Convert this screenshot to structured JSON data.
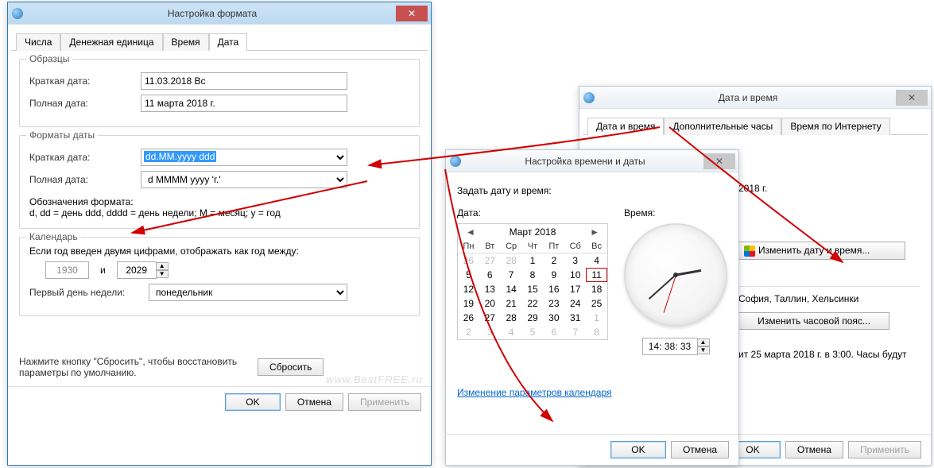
{
  "win1": {
    "title": "Настройка формата",
    "tabs": [
      "Числа",
      "Денежная единица",
      "Время",
      "Дата"
    ],
    "samples": {
      "group": "Образцы",
      "short_label": "Краткая дата:",
      "short_value": "11.03.2018 Вс",
      "long_label": "Полная дата:",
      "long_value": "11 марта 2018 г."
    },
    "formats": {
      "group": "Форматы даты",
      "short_label": "Краткая дата:",
      "short_value": "dd.MM.yyyy ddd",
      "long_label": "Полная дата:",
      "long_value": "d MMMM yyyy 'г.'",
      "legend_label": "Обозначения формата:",
      "legend_text": "d, dd = день  ddd, dddd = день недели; M = месяц; y = год"
    },
    "calendar": {
      "group": "Календарь",
      "range_label": "Если год введен двумя цифрами, отображать как год между:",
      "year_from": "1930",
      "year_to": "2029",
      "and": "и",
      "firstday_label": "Первый день недели:",
      "firstday_value": "понедельник"
    },
    "reset_hint": "Нажмите кнопку \"Сбросить\", чтобы восстановить параметры по умолчанию.",
    "reset": "Сбросить",
    "ok": "OK",
    "cancel": "Отмена",
    "apply": "Применить",
    "watermark": "www.BestFREE.ru"
  },
  "win2": {
    "title": "Настройка времени и даты",
    "set_label": "Задать дату и время:",
    "date_label": "Дата:",
    "time_label": "Время:",
    "month": "Март 2018",
    "dow": [
      "Пн",
      "Вт",
      "Ср",
      "Чт",
      "Пт",
      "Сб",
      "Вс"
    ],
    "grid": [
      [
        "26",
        "27",
        "28",
        "1",
        "2",
        "3",
        "4"
      ],
      [
        "5",
        "6",
        "7",
        "8",
        "9",
        "10",
        "11"
      ],
      [
        "12",
        "13",
        "14",
        "15",
        "16",
        "17",
        "18"
      ],
      [
        "19",
        "20",
        "21",
        "22",
        "23",
        "24",
        "25"
      ],
      [
        "26",
        "27",
        "28",
        "29",
        "30",
        "31",
        "1"
      ],
      [
        "2",
        "3",
        "4",
        "5",
        "6",
        "7",
        "8"
      ]
    ],
    "time": "14: 38: 33",
    "link": "Изменение параметров календаря",
    "ok": "OK",
    "cancel": "Отмена"
  },
  "win3": {
    "title": "Дата и время",
    "tabs": [
      "Дата и время",
      "Дополнительные часы",
      "Время по Интернету"
    ],
    "date_frag": "2018 г.",
    "change_dt": "Изменить дату и время...",
    "tz_frag": "София, Таллин, Хельсинки",
    "change_tz": "Изменить часовой пояс...",
    "dst_frag": "ит 25 марта 2018 г. в 3:00. Часы будут",
    "ok": "OK",
    "cancel": "Отмена",
    "apply": "Применить"
  }
}
